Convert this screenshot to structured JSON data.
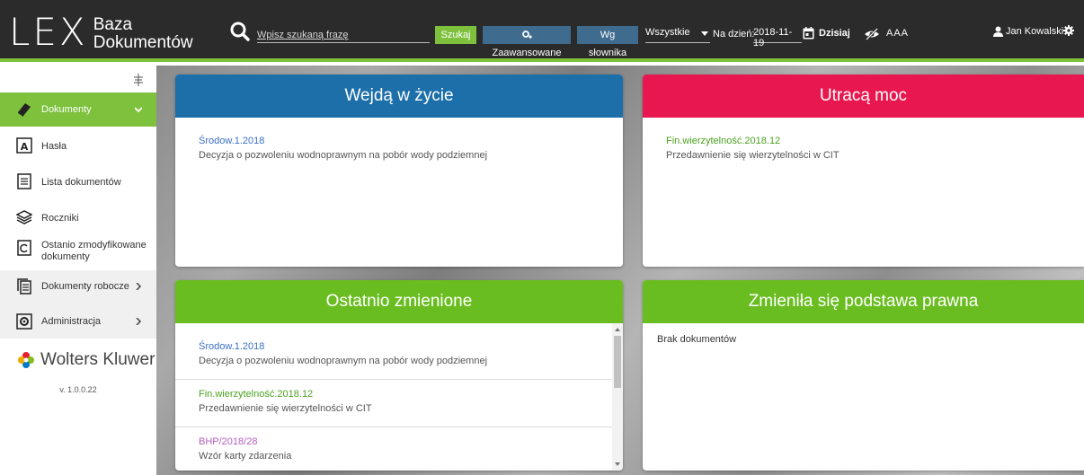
{
  "header": {
    "logo_main": "LEX",
    "logo_sub_line1": "Baza",
    "logo_sub_line2": "Dokumentów",
    "search_placeholder": "Wpisz szukaną frazę",
    "search_button": "Szukaj",
    "advanced_button": "Zaawansowane",
    "dictionary_button": "Wg słownika",
    "filter_value": "Wszystkie",
    "date_label": "Na dzień:",
    "date_value": "2018-11-19",
    "today_label": "Dzisiaj",
    "font_size_label": "AAA",
    "user_name": "Jan Kowalski"
  },
  "sidebar": {
    "items": [
      {
        "label": "Dokumenty",
        "icon": "book-icon"
      },
      {
        "label": "Hasła",
        "icon": "letter-a-icon"
      },
      {
        "label": "Lista dokumentów",
        "icon": "checklist-icon"
      },
      {
        "label": "Roczniki",
        "icon": "layers-icon"
      },
      {
        "label": "Ostanio zmodyfikowane dokumenty",
        "icon": "modified-doc-icon"
      },
      {
        "label": "Dokumenty robocze",
        "icon": "draft-docs-icon"
      },
      {
        "label": "Administracja",
        "icon": "admin-gear-icon"
      }
    ],
    "brand": "Wolters Kluwer",
    "version": "v. 1.0.0.22"
  },
  "cards": {
    "wejda": {
      "title": "Wejdą w życie",
      "color": "#1d6fa9",
      "entries": [
        {
          "title": "Środow.1.2018",
          "desc": "Decyzja o pozwoleniu wodnoprawnym na pobór wody podziemnej"
        }
      ]
    },
    "utraca": {
      "title": "Utracą moc",
      "color": "#e8174f",
      "entries": [
        {
          "title": "Fin.wierzytelność.2018.12",
          "desc": "Przedawnienie się wierzytelności w CIT"
        }
      ]
    },
    "ostatnio": {
      "title": "Ostatnio zmienione",
      "color": "#6abd21",
      "entries": [
        {
          "title": "Środow.1.2018",
          "desc": "Decyzja o pozwoleniu wodnoprawnym na pobór wody podziemnej"
        },
        {
          "title": "Fin.wierzytelność.2018.12",
          "desc": "Przedawnienie się wierzytelności w CIT"
        },
        {
          "title": "BHP/2018/28",
          "desc": "Wzór karty zdarzenia"
        }
      ]
    },
    "podstawa": {
      "title": "Zmieniła się podstawa prawna",
      "color": "#6abd21",
      "empty_text": "Brak dokumentów"
    }
  }
}
